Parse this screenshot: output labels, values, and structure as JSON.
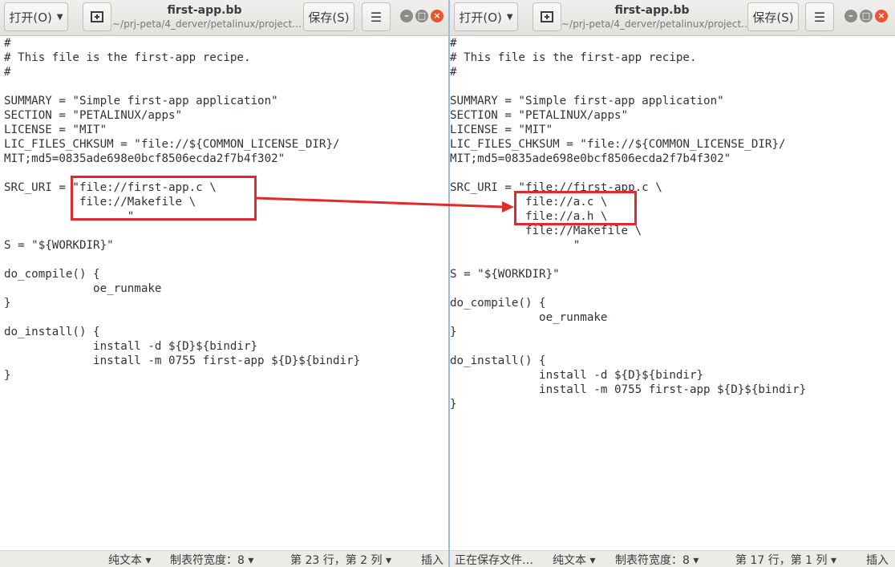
{
  "left": {
    "open_label": "打开(O)",
    "title": "first-app.bb",
    "path": "~/prj-peta/4_derver/petalinux/project…",
    "save_label": "保存(S)",
    "code": "#\n# This file is the first-app recipe.\n#\n\nSUMMARY = \"Simple first-app application\"\nSECTION = \"PETALINUX/apps\"\nLICENSE = \"MIT\"\nLIC_FILES_CHKSUM = \"file://${COMMON_LICENSE_DIR}/\nMIT;md5=0835ade698e0bcf8506ecda2f7b4f302\"\n\nSRC_URI = \"file://first-app.c \\\n           file://Makefile \\\n                  \"\n\nS = \"${WORKDIR}\"\n\ndo_compile() {\n             oe_runmake\n}\n\ndo_install() {\n             install -d ${D}${bindir}\n             install -m 0755 first-app ${D}${bindir}\n}",
    "status": {
      "lang": "纯文本",
      "tab_width": "制表符宽度：8",
      "position": "第 23 行，第 2 列",
      "mode": "插入"
    }
  },
  "right": {
    "open_label": "打开(O)",
    "title": "first-app.bb",
    "path": "~/prj-peta/4_derver/petalinux/project…",
    "save_label": "保存(S)",
    "code": "#\n# This file is the first-app recipe.\n#\n\nSUMMARY = \"Simple first-app application\"\nSECTION = \"PETALINUX/apps\"\nLICENSE = \"MIT\"\nLIC_FILES_CHKSUM = \"file://${COMMON_LICENSE_DIR}/\nMIT;md5=0835ade698e0bcf8506ecda2f7b4f302\"\n\nSRC_URI = \"file://first-app.c \\\n           file://a.c \\\n           file://a.h \\\n           file://Makefile \\\n                  \"\n\nS = \"${WORKDIR}\"\n\ndo_compile() {\n             oe_runmake\n}\n\ndo_install() {\n             install -d ${D}${bindir}\n             install -m 0755 first-app ${D}${bindir}\n}",
    "status": {
      "saving": "正在保存文件…",
      "lang": "纯文本",
      "tab_width": "制表符宽度：8",
      "position": "第 17 行，第 1 列",
      "mode": "插入"
    }
  },
  "colors": {
    "annotation": "#e12a2a",
    "close_button": "#e9542d"
  }
}
